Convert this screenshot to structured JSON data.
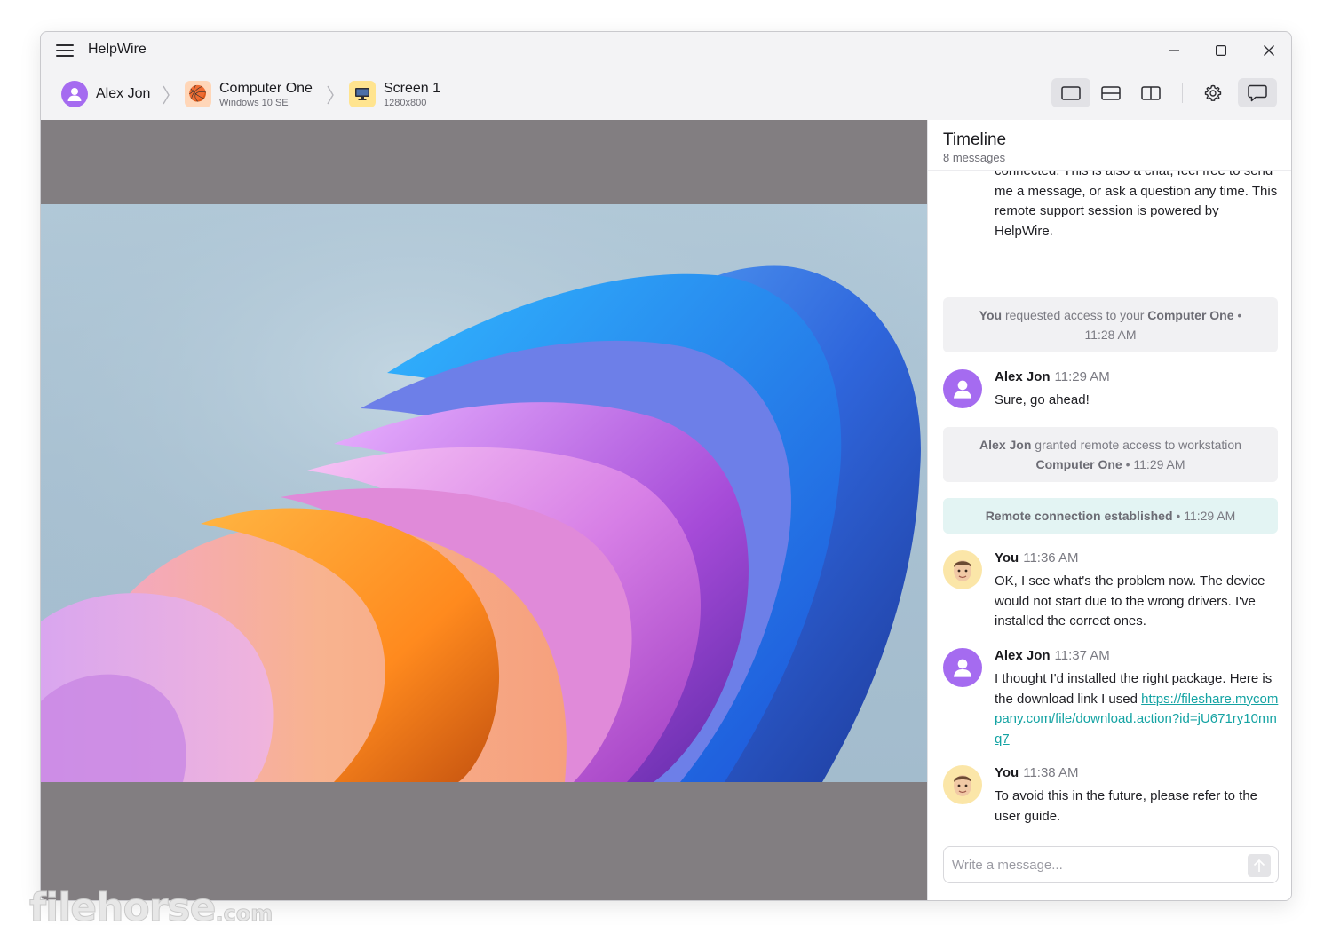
{
  "app": {
    "title": "HelpWire"
  },
  "breadcrumb": {
    "user": {
      "name": "Alex Jon"
    },
    "computer": {
      "name": "Computer One",
      "os": "Windows 10 SE"
    },
    "screen": {
      "name": "Screen 1",
      "resolution": "1280x800"
    }
  },
  "toolbar": {
    "view_modes": [
      "single-view",
      "split-horizontal",
      "split-vertical"
    ],
    "active_view": "single-view"
  },
  "timeline": {
    "title": "Timeline",
    "count": "8 messages",
    "intro_text": "Hi! I'm happy to assist. Here you'll see the timeline of all events taking place when we are connected. This is also a chat, feel free to send me a message, or ask a question any time. This remote support session is powered by HelpWire.",
    "event1": {
      "actor": "You",
      "text": " requested access to your ",
      "target": "Computer One",
      "time": " • 11:28 AM"
    },
    "msg1": {
      "name": "Alex Jon",
      "time": "11:29 AM",
      "text": "Sure, go ahead!"
    },
    "event2": {
      "actor": "Alex Jon",
      "text": " granted remote access to workstation ",
      "target": "Computer One",
      "time": " • 11:29 AM"
    },
    "event3": {
      "text": "Remote connection established",
      "time": " • 11:29 AM"
    },
    "msg2": {
      "name": "You",
      "time": "11:36 AM",
      "text": "OK, I see what's the problem now. The device would not start due to the wrong drivers. I've installed the correct ones."
    },
    "msg3": {
      "name": "Alex Jon",
      "time": "11:37 AM",
      "text": "I thought I'd installed the right package. Here is the download link I used ",
      "link": "https://fileshare.mycompany.com/file/download.action?id=jU671ry10mnq7"
    },
    "msg4": {
      "name": "You",
      "time": "11:38 AM",
      "text": "To avoid this in the future, please refer to the user guide."
    }
  },
  "composer": {
    "placeholder": "Write a message..."
  },
  "watermark": {
    "main": "filehorse",
    "suffix": ".com"
  },
  "colors": {
    "accent_teal": "#14a3a3",
    "avatar_purple": "#a56bf0",
    "viewer_gray": "#827e81"
  }
}
